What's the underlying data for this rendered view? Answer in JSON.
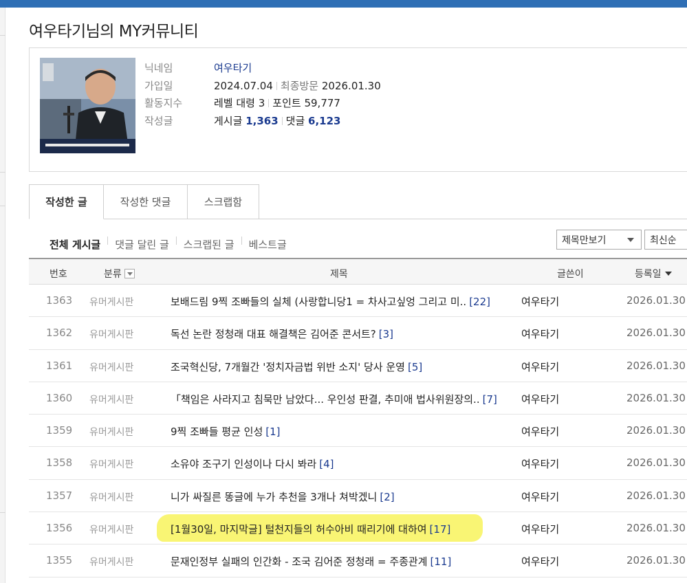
{
  "page_title": "여우타기님의 MY커뮤니티",
  "profile": {
    "labels": {
      "nickname": "닉네임",
      "joined": "가입일",
      "activity": "활동지수",
      "posts": "작성글"
    },
    "nickname": "여우타기",
    "joined_date": "2024.07.04",
    "last_visit_label": "최종방문",
    "last_visit_date": "2026.01.30",
    "level_text": "레벨 대령 3",
    "points_label": "포인트",
    "points": "59,777",
    "posts_label": "게시글",
    "posts_count": "1,363",
    "comments_label": "댓글",
    "comments_count": "6,123"
  },
  "tabs": [
    {
      "label": "작성한 글",
      "active": true
    },
    {
      "label": "작성한 댓글",
      "active": false
    },
    {
      "label": "스크랩함",
      "active": false
    }
  ],
  "subnav": [
    {
      "label": "전체 게시글",
      "active": true
    },
    {
      "label": "댓글 달린 글",
      "active": false
    },
    {
      "label": "스크랩된 글",
      "active": false
    },
    {
      "label": "베스트글",
      "active": false
    }
  ],
  "view_select": {
    "value": "제목만보기"
  },
  "sort_select": {
    "value": "최신순"
  },
  "table": {
    "headers": {
      "no": "번호",
      "category": "분류",
      "title": "제목",
      "writer": "글쓴이",
      "date": "등록일"
    },
    "rows": [
      {
        "no": "1363",
        "category": "유머게시판",
        "title": "보배드림 9찍 조빠들의 실체 (사랑합니당1 = 차사고싶엉 그리고 미..",
        "comments": "[22]",
        "writer": "여우타기",
        "date": "2026.01.30"
      },
      {
        "no": "1362",
        "category": "유머게시판",
        "title": "독선 논란 정청래 대표 해결책은 김어준 콘서트?",
        "comments": "[3]",
        "writer": "여우타기",
        "date": "2026.01.30"
      },
      {
        "no": "1361",
        "category": "유머게시판",
        "title": "조국혁신당, 7개월간 '정치자금법 위반 소지' 당사 운영",
        "comments": "[5]",
        "writer": "여우타기",
        "date": "2026.01.30"
      },
      {
        "no": "1360",
        "category": "유머게시판",
        "title": "「책임은 사라지고 침묵만 남았다... 우인성 판결, 추미애 법사위원장의..",
        "comments": "[7]",
        "writer": "여우타기",
        "date": "2026.01.30"
      },
      {
        "no": "1359",
        "category": "유머게시판",
        "title": "9찍 조빠들 평균 인성",
        "comments": "[1]",
        "writer": "여우타기",
        "date": "2026.01.30"
      },
      {
        "no": "1358",
        "category": "유머게시판",
        "title": "소유야 조구기 인성이나 다시 봐라",
        "comments": "[4]",
        "writer": "여우타기",
        "date": "2026.01.30"
      },
      {
        "no": "1357",
        "category": "유머게시판",
        "title": "니가 싸질른 똥글에 누가 추천을 3개나 쳐박겠니",
        "comments": "[2]",
        "writer": "여우타기",
        "date": "2026.01.30"
      },
      {
        "no": "1356",
        "category": "유머게시판",
        "title": "[1월30일, 마지막글] 털천지들의 허수아비 때리기에 대하여",
        "comments": "[17]",
        "writer": "여우타기",
        "date": "2026.01.30",
        "highlighted": true
      },
      {
        "no": "1355",
        "category": "유머게시판",
        "title": "문재인정부 실패의 인간화 - 조국 김어준 정청래 = 주종관계",
        "comments": "[11]",
        "writer": "여우타기",
        "date": "2026.01.30"
      }
    ]
  },
  "colors": {
    "top_bar": "#2f6fb5",
    "link_blue": "#1a3a8f",
    "highlight": "#f8f35c"
  }
}
